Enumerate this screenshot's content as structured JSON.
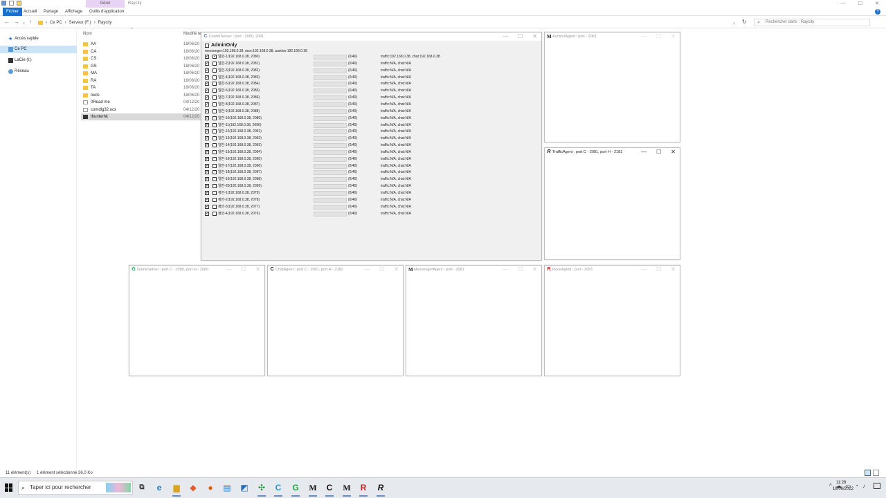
{
  "explorer": {
    "context_tab": "Gérer",
    "app_name": "Raycity",
    "ribbon_tabs": [
      "Fichier",
      "Accueil",
      "Partage",
      "Affichage",
      "Outils d'application"
    ],
    "address": [
      "Ce PC",
      "Serveur (F:)",
      "Raycity"
    ],
    "search_placeholder": "Rechercher dans : Raycity",
    "nav": [
      "Accès rapide",
      "Ce PC",
      "LaCie (I:)",
      "Réseau"
    ],
    "col_name": "Nom",
    "col_modified": "Modifié le",
    "files": [
      {
        "name": "AA",
        "date": "18/06/20",
        "kind": "folder"
      },
      {
        "name": "CA",
        "date": "18/06/20",
        "kind": "folder"
      },
      {
        "name": "CS",
        "date": "18/06/20",
        "kind": "folder"
      },
      {
        "name": "GS",
        "date": "18/06/20",
        "kind": "folder"
      },
      {
        "name": "MA",
        "date": "18/06/20",
        "kind": "folder"
      },
      {
        "name": "RA",
        "date": "18/06/20",
        "kind": "folder"
      },
      {
        "name": "TA",
        "date": "18/06/20",
        "kind": "folder"
      },
      {
        "name": "tools",
        "date": "18/06/20",
        "kind": "folder"
      },
      {
        "name": "0Read me",
        "date": "04/12/20",
        "kind": "doc"
      },
      {
        "name": "comdlg32.ocx",
        "date": "04/12/20",
        "kind": "doc"
      },
      {
        "name": "thunterhk",
        "date": "04/12/20",
        "kind": "exe"
      }
    ],
    "status_count": "11 élément(s)",
    "status_selected": "1 élément sélectionné 36,0 Ko"
  },
  "center": {
    "title": "CenterServer : port - 2080, 2081",
    "admin_label": "AdminOnly",
    "info": "messenger:192.168.0.38, race:192.168.0.38, auction:192.168.0.38",
    "rows": [
      {
        "label": "일반-1(192.168.0.38, 2080)",
        "count": "(0/40)",
        "status": "traffic:192.168.0.38, chat:192.168.0.38"
      },
      {
        "label": "일반-2(192.168.0.38, 2081)",
        "count": "(0/40)",
        "status": "traffic:N/A, chat:N/A"
      },
      {
        "label": "일반-3(192.168.0.38, 2082)",
        "count": "(0/40)",
        "status": "traffic:N/A, chat:N/A"
      },
      {
        "label": "일반-4(192.168.0.38, 2083)",
        "count": "(0/40)",
        "status": "traffic:N/A, chat:N/A"
      },
      {
        "label": "일반-5(192.168.0.38, 2084)",
        "count": "(0/40)",
        "status": "traffic:N/A, chat:N/A"
      },
      {
        "label": "일반-6(192.168.0.38, 2085)",
        "count": "(0/40)",
        "status": "traffic:N/A, chat:N/A"
      },
      {
        "label": "일반-7(192.168.0.38, 2086)",
        "count": "(0/40)",
        "status": "traffic:N/A, chat:N/A"
      },
      {
        "label": "일반-8(192.168.0.38, 2087)",
        "count": "(0/40)",
        "status": "traffic:N/A, chat:N/A"
      },
      {
        "label": "일반-9(192.168.0.38, 2088)",
        "count": "(0/40)",
        "status": "traffic:N/A, chat:N/A"
      },
      {
        "label": "일반-10(192.168.0.38, 2089)",
        "count": "(0/40)",
        "status": "traffic:N/A, chat:N/A"
      },
      {
        "label": "일반-11(192.168.0.38, 2090)",
        "count": "(0/40)",
        "status": "traffic:N/A, chat:N/A"
      },
      {
        "label": "일반-12(192.168.0.38, 2091)",
        "count": "(0/40)",
        "status": "traffic:N/A, chat:N/A"
      },
      {
        "label": "일반-13(192.168.0.38, 2092)",
        "count": "(0/40)",
        "status": "traffic:N/A, chat:N/A"
      },
      {
        "label": "일반-14(192.168.0.38, 2093)",
        "count": "(0/40)",
        "status": "traffic:N/A, chat:N/A"
      },
      {
        "label": "일반-15(192.168.0.38, 2094)",
        "count": "(0/40)",
        "status": "traffic:N/A, chat:N/A"
      },
      {
        "label": "일반-16(192.168.0.38, 2095)",
        "count": "(0/40)",
        "status": "traffic:N/A, chat:N/A"
      },
      {
        "label": "일반-17(192.168.0.38, 2096)",
        "count": "(0/40)",
        "status": "traffic:N/A, chat:N/A"
      },
      {
        "label": "일반-18(192.168.0.38, 2097)",
        "count": "(0/40)",
        "status": "traffic:N/A, chat:N/A"
      },
      {
        "label": "일반-19(192.168.0.38, 2098)",
        "count": "(0/40)",
        "status": "traffic:N/A, chat:N/A"
      },
      {
        "label": "일반-20(192.168.0.38, 2099)",
        "count": "(0/40)",
        "status": "traffic:N/A, chat:N/A"
      },
      {
        "label": "정안-1(192.168.0.38, 2079)",
        "count": "(0/40)",
        "status": "traffic:N/A, chat:N/A"
      },
      {
        "label": "정안-2(192.168.0.38, 2078)",
        "count": "(0/40)",
        "status": "traffic:N/A, chat:N/A"
      },
      {
        "label": "정안-3(192.168.0.38, 2077)",
        "count": "(0/40)",
        "status": "traffic:N/A, chat:N/A"
      },
      {
        "label": "정안-4(192.168.0.38, 2076)",
        "count": "(0/40)",
        "status": "traffic:N/A, chat:N/A"
      }
    ]
  },
  "windows": {
    "auction": "AuctionAgent : port - 2081",
    "traffic": "TrafficAgent : port C - 2081, port H - 2181",
    "game": "GameServer : port C - 2080, port H - 2080",
    "chat": "ChatAgent : port C - 2081, port H - 2182",
    "messenger": "MessengerAgent : port - 2081",
    "race": "RaceAgent : port - 2081"
  },
  "taskbar": {
    "search_placeholder": "Taper ici pour rechercher",
    "time": "11:28",
    "date": "18/06/2022"
  },
  "colors": {
    "accent": "#1a6fc9",
    "progress": "#06b025",
    "context_tab": "#e8d3f5"
  }
}
